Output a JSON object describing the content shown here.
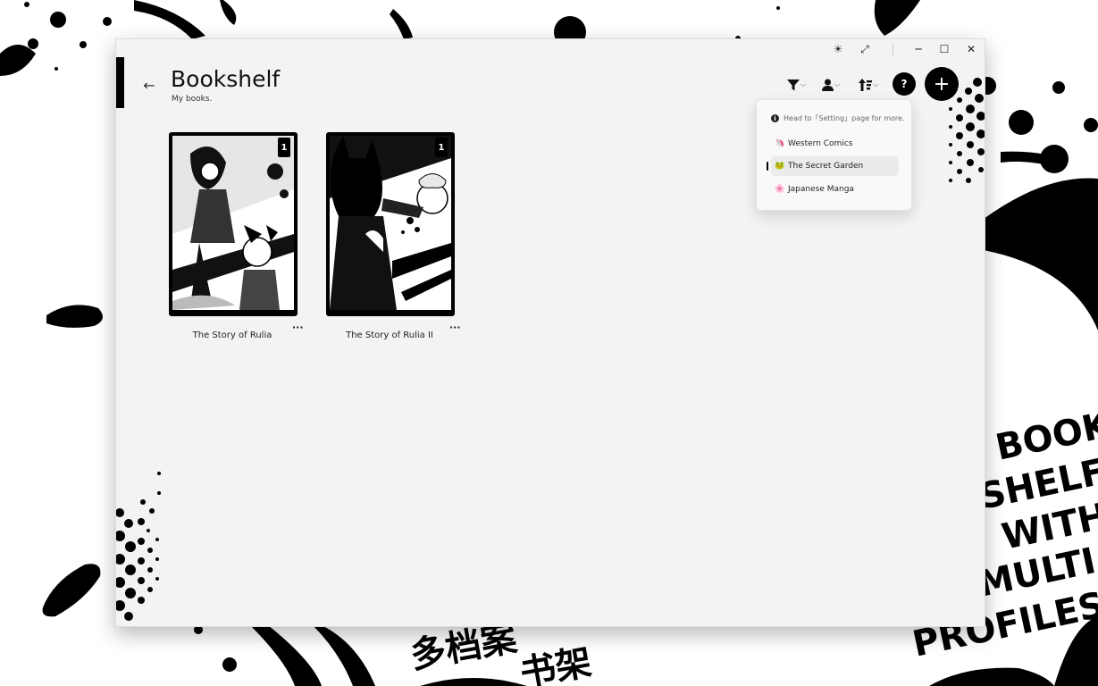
{
  "window": {
    "caption": {
      "theme_icon": "☀",
      "fullscreen_icon": "⤢",
      "minimize": "─",
      "maximize": "☐",
      "close": "✕"
    }
  },
  "header": {
    "back_icon": "←",
    "title": "Bookshelf",
    "subtitle": "My books."
  },
  "toolbar": {
    "filter_icon": "funnel-icon",
    "profile_icon": "person-icon",
    "sort_icon": "sort-icon",
    "chevron": "⌵",
    "help_label": "?",
    "add_label": "+"
  },
  "books": [
    {
      "title": "The Story of Rulia",
      "badge": "1",
      "more": "···"
    },
    {
      "title": "The Story of Rulia II",
      "badge": "1",
      "more": "···"
    }
  ],
  "profile_menu": {
    "hint": "Head to「Setting」page for more.",
    "items": [
      {
        "emoji": "🦄",
        "label": "Western Comics",
        "selected": false
      },
      {
        "emoji": "🐸",
        "label": "The Secret Garden",
        "selected": true
      },
      {
        "emoji": "🌸",
        "label": "Japanese Manga",
        "selected": false
      }
    ]
  },
  "background_art": {
    "text_en": [
      "BOOK",
      "SHELF",
      "WITH",
      "MULTI",
      "PROFILES"
    ],
    "text_zh": [
      "多档案",
      "书架"
    ]
  },
  "colors": {
    "accent": "#000000",
    "window_bg": "#f3f3f3",
    "menu_selected": "#ebebeb"
  }
}
